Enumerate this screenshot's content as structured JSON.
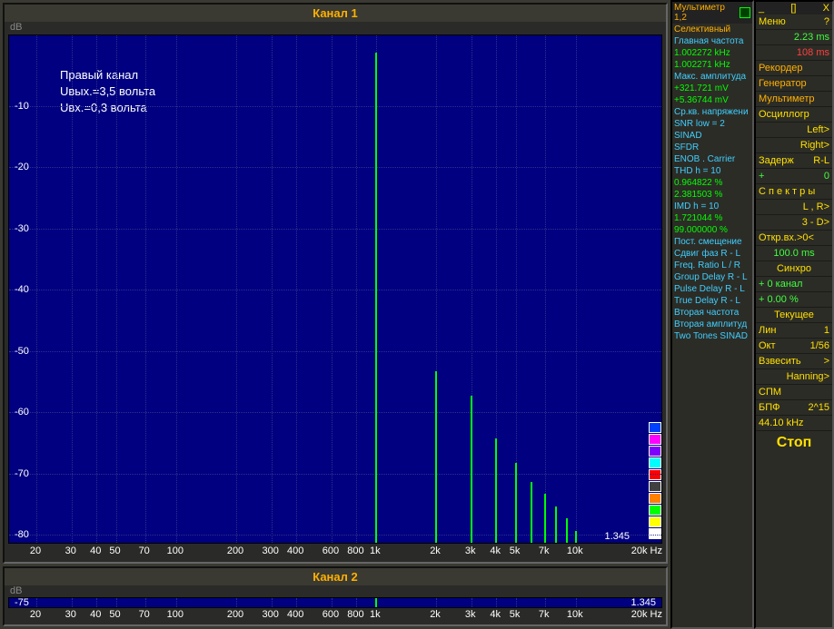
{
  "panel1": {
    "title": "Канал 1",
    "yunit": "dB",
    "right_info": "1.345",
    "xunit_right": "20k  Hz",
    "overlay": {
      "line1": "Правый канал",
      "line2": "Uвых.=3,5 вольта",
      "line3": "Uвх.=0,3 вольта"
    },
    "yticks": [
      "-10",
      "-20",
      "-30",
      "-40",
      "-50",
      "-60",
      "-70",
      "-80"
    ],
    "xticks": [
      "20",
      "30",
      "40",
      "50",
      "70",
      "100",
      "200",
      "300",
      "400",
      "600",
      "800",
      "1k",
      "2k",
      "3k",
      "4k",
      "5k",
      "7k",
      "10k"
    ]
  },
  "panel2": {
    "title": "Канал 2",
    "yunit": "dB",
    "ytick": "-75",
    "right_info": "1.345",
    "xunit_right": "20k  Hz",
    "xticks": [
      "20",
      "30",
      "40",
      "50",
      "70",
      "100",
      "200",
      "300",
      "400",
      "600",
      "800",
      "1k",
      "2k",
      "3k",
      "4k",
      "5k",
      "7k",
      "10k"
    ]
  },
  "multimeter": {
    "title": "Мультиметр 1,2",
    "rows": [
      {
        "t": "Селективный",
        "c": "orange"
      },
      {
        "t": "Главная частота",
        "c": "cyan"
      },
      {
        "t": " 1.002272 kHz",
        "c": "green"
      },
      {
        "t": " 1.002271 kHz",
        "c": "green"
      },
      {
        "t": "Макс. амплитуда",
        "c": "cyan"
      },
      {
        "t": " +321.721 mV",
        "c": "green"
      },
      {
        "t": "  +5.36744 mV",
        "c": "green"
      },
      {
        "t": "Ср.кв. напряжени",
        "c": "cyan"
      },
      {
        "t": "SNR    low = 2",
        "c": "cyan"
      },
      {
        "t": "SINAD",
        "c": "cyan"
      },
      {
        "t": "SFDR",
        "c": "cyan"
      },
      {
        "t": "ENOB . Carrier",
        "c": "cyan"
      },
      {
        "t": "THD    h = 10",
        "c": "cyan"
      },
      {
        "t": "  0.964822 %",
        "c": "green"
      },
      {
        "t": "  2.381503 %",
        "c": "green"
      },
      {
        "t": "IMD    h = 10",
        "c": "cyan"
      },
      {
        "t": "  1.721044 %",
        "c": "green"
      },
      {
        "t": " 99.000000 %",
        "c": "green"
      },
      {
        "t": "Пост. смещение",
        "c": "cyan"
      },
      {
        "t": "Сдвиг фаз R - L",
        "c": "cyan"
      },
      {
        "t": "Freq. Ratio  L / R",
        "c": "cyan"
      },
      {
        "t": "Group Delay R - L",
        "c": "cyan"
      },
      {
        "t": "Pulse Delay R - L",
        "c": "cyan"
      },
      {
        "t": "True  Delay R - L",
        "c": "cyan"
      },
      {
        "t": "Вторая частота",
        "c": "cyan"
      },
      {
        "t": "Вторая амплитуд",
        "c": "cyan"
      },
      {
        "t": "Two Tones SINAD",
        "c": "cyan"
      }
    ]
  },
  "menu": {
    "head_left": "Меню",
    "head_q": "?",
    "win_min": "_",
    "win_max": "[]",
    "win_close": "X",
    "val1": "2.23 ms",
    "val2": "108  ms",
    "rows": [
      {
        "l": "Рекордер",
        "r": "",
        "c": "orange"
      },
      {
        "l": "Генератор",
        "r": "",
        "c": "orange"
      },
      {
        "l": "Мультиметр",
        "r": "",
        "c": "orange"
      },
      {
        "l": "Осциллогр",
        "r": "",
        "c": "yellow"
      },
      {
        "l": "Left",
        "r": ">",
        "c": "yellow",
        "align": "right"
      },
      {
        "l": "Right",
        "r": ">",
        "c": "yellow",
        "align": "right"
      },
      {
        "l": "Задерж",
        "r": "R-L",
        "c": "yellow"
      },
      {
        "l": "+",
        "r": "0",
        "c": "greent"
      },
      {
        "l": "С п е к т р ы",
        "r": "",
        "c": "yellow"
      },
      {
        "l": "L , R",
        "r": ">",
        "c": "yellow",
        "align": "right"
      },
      {
        "l": "3 - D",
        "r": ">",
        "c": "yellow",
        "align": "right"
      },
      {
        "l": "Откр.вх.>0<",
        "r": "",
        "c": "yellow"
      },
      {
        "l": "100.0 ms",
        "r": "",
        "c": "greent",
        "align": "center"
      },
      {
        "l": "Синхро",
        "r": "",
        "c": "yellow",
        "align": "center"
      },
      {
        "l": "+  0 канал",
        "r": "",
        "c": "greent"
      },
      {
        "l": "+  0.00 %",
        "r": "",
        "c": "greent"
      },
      {
        "l": "Текущее",
        "r": "",
        "c": "yellow",
        "align": "center"
      },
      {
        "l": "Лин",
        "r": "1",
        "c": "yellow"
      },
      {
        "l": "Окт",
        "r": "1/56",
        "c": "yellow"
      },
      {
        "l": "Взвесить",
        "r": ">",
        "c": "yellow"
      },
      {
        "l": "Hanning",
        "r": ">",
        "c": "yellow",
        "align": "right"
      },
      {
        "l": "СПМ",
        "r": "",
        "c": "yellow"
      },
      {
        "l": "БПФ",
        "r": "2^15",
        "c": "yellow"
      },
      {
        "l": "44.10 kHz",
        "r": "",
        "c": "yellow"
      }
    ],
    "stop": "Стоп"
  },
  "colorbox": [
    "#0040ff",
    "#ff00ff",
    "#8000ff",
    "#00ffff",
    "#ff0000",
    "#404040",
    "#ff8000",
    "#00ff00",
    "#ffff00",
    "#ffffff"
  ],
  "chart_data": {
    "type": "bar",
    "title": "Канал 1 — Правый канал",
    "xlabel": "Hz (log)",
    "ylabel": "dB",
    "ylim": [
      -80,
      0
    ],
    "xrange_hz": [
      20,
      20000
    ],
    "annotations": [
      "Uвых.=3,5 вольта",
      "Uвх.=0,3 вольта"
    ],
    "series": [
      {
        "name": "Правый канал",
        "x_hz": [
          1000,
          2000,
          3000,
          4000,
          5000,
          6000,
          7000,
          8000,
          9000,
          10000
        ],
        "y_db": [
          0,
          -52,
          -56,
          -63,
          -67,
          -70,
          -72,
          -74,
          -76,
          -78
        ]
      }
    ]
  }
}
